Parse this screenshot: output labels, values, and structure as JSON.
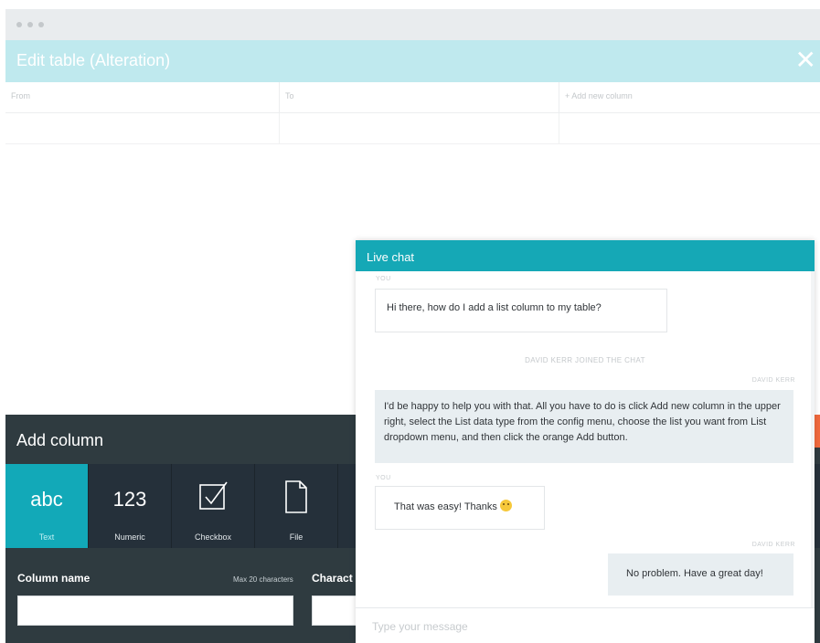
{
  "edit_table": {
    "title": "Edit table (Alteration)",
    "columns": [
      "From",
      "To",
      "+ Add new column"
    ]
  },
  "add_column": {
    "title": "Add column",
    "types": [
      {
        "glyph": "abc",
        "label": "Text",
        "icon": "text-icon"
      },
      {
        "glyph": "123",
        "label": "Numeric",
        "icon": "numeric-icon"
      },
      {
        "glyph": "",
        "label": "Checkbox",
        "icon": "checkbox-icon"
      },
      {
        "glyph": "",
        "label": "File",
        "icon": "file-icon"
      }
    ],
    "column_name_label": "Column name",
    "max_chars_note": "Max 20 characters",
    "second_field_label": "Charact",
    "active_color": "#12a9b8",
    "accent_orange": "#f26a3e"
  },
  "chat": {
    "title": "Live chat",
    "header_color": "#15a8b6",
    "messages": [
      {
        "sender": "YOU",
        "text": "Hi there, how do I add a list column to my table?"
      },
      {
        "system": "DAVID KERR JOINED THE CHAT"
      },
      {
        "sender": "DAVID KERR",
        "text": "I'd be happy to help you with that. All you have to do is click Add new column in the upper right, select the List data type from the config menu, choose the list you want from List dropdown menu, and then click the orange Add button."
      },
      {
        "sender": "YOU",
        "text": "That was easy! Thanks"
      },
      {
        "sender": "DAVID KERR",
        "text": "No problem. Have a great day!"
      }
    ],
    "input_placeholder": "Type your message"
  }
}
